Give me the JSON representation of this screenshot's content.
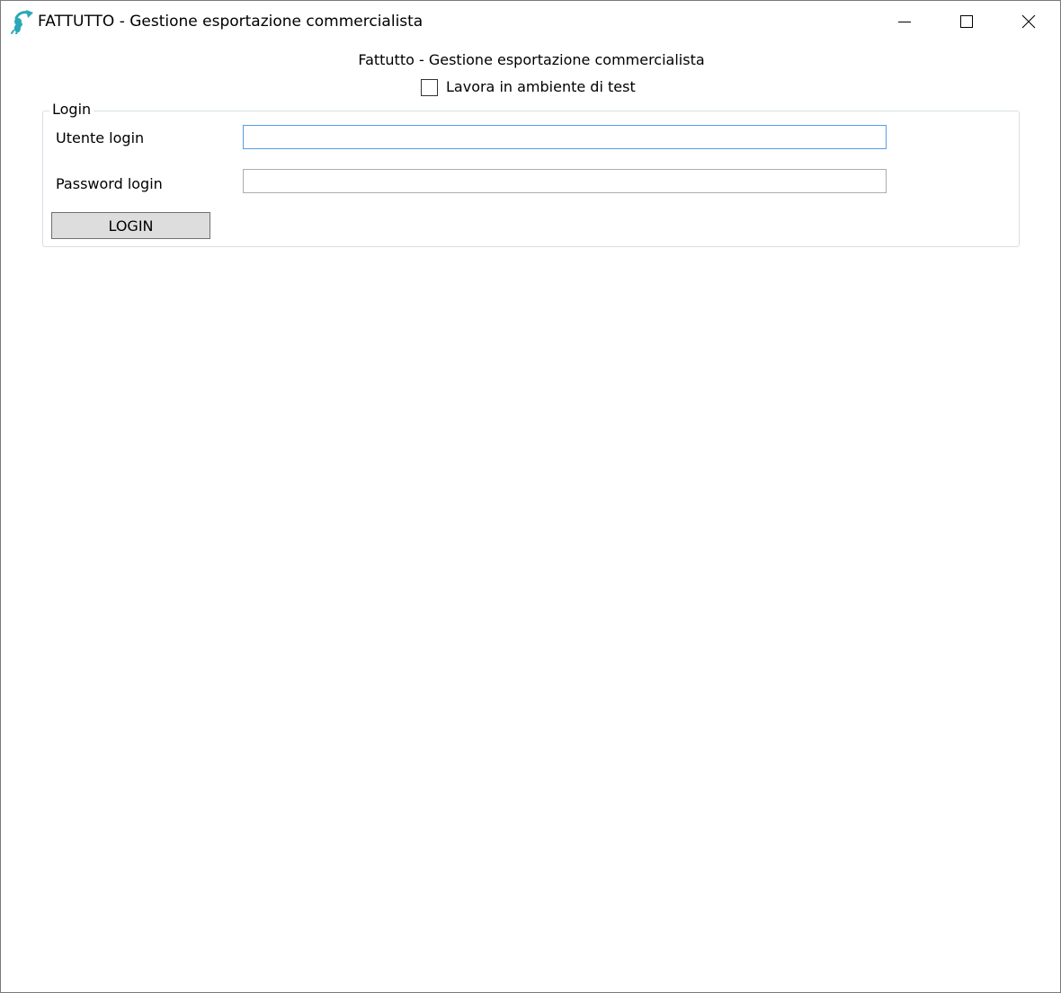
{
  "window": {
    "title": "FATTUTTO - Gestione esportazione commercialista",
    "icon": "app-logo-icon",
    "controls": [
      "minimize-icon",
      "maximize-icon",
      "close-icon"
    ]
  },
  "header": {
    "title": "Fattutto - Gestione esportazione commercialista",
    "test_checkbox_label": "Lavora in ambiente di test",
    "test_checkbox_checked": false
  },
  "login": {
    "group_label": "Login",
    "user_label": "Utente login",
    "user_value": "",
    "password_label": "Password login",
    "password_value": "",
    "button_label": "LOGIN"
  },
  "colors": {
    "accent": "#569de5",
    "icon_teal": "#2aa8b8",
    "button_bg": "#dddddd"
  }
}
